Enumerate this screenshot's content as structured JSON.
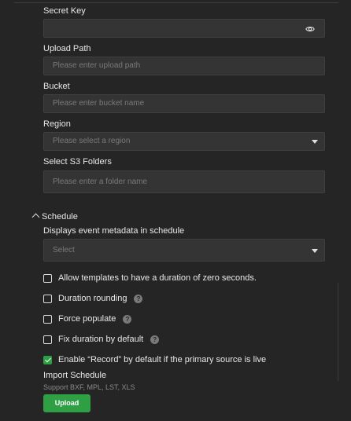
{
  "form": {
    "secret_key": {
      "label": "Secret Key",
      "value": ""
    },
    "upload_path": {
      "label": "Upload Path",
      "placeholder": "Please enter upload path"
    },
    "bucket": {
      "label": "Bucket",
      "placeholder": "Please enter bucket name"
    },
    "region": {
      "label": "Region",
      "placeholder": "Please select a region"
    },
    "s3_folders": {
      "label": "Select S3 Folders",
      "placeholder": "Please enter a folder name"
    }
  },
  "schedule": {
    "title": "Schedule",
    "metadata_label": "Displays event metadata in schedule",
    "metadata_placeholder": "Select",
    "options": [
      {
        "label": "Allow templates to have a duration of zero seconds.",
        "checked": false,
        "help": false
      },
      {
        "label": "Duration rounding",
        "checked": false,
        "help": true
      },
      {
        "label": "Force populate",
        "checked": false,
        "help": true
      },
      {
        "label": "Fix duration by default",
        "checked": false,
        "help": true
      },
      {
        "label": "Enable “Record” by default if the primary source is live",
        "checked": true,
        "help": false
      }
    ],
    "help_glyph": "?"
  },
  "import": {
    "label": "Import Schedule",
    "hint": "Support BXF, MPL, LST, XLS",
    "button_label": "Upload"
  },
  "colors": {
    "accent": "#2ea043",
    "background": "#252525",
    "field": "#343434"
  }
}
